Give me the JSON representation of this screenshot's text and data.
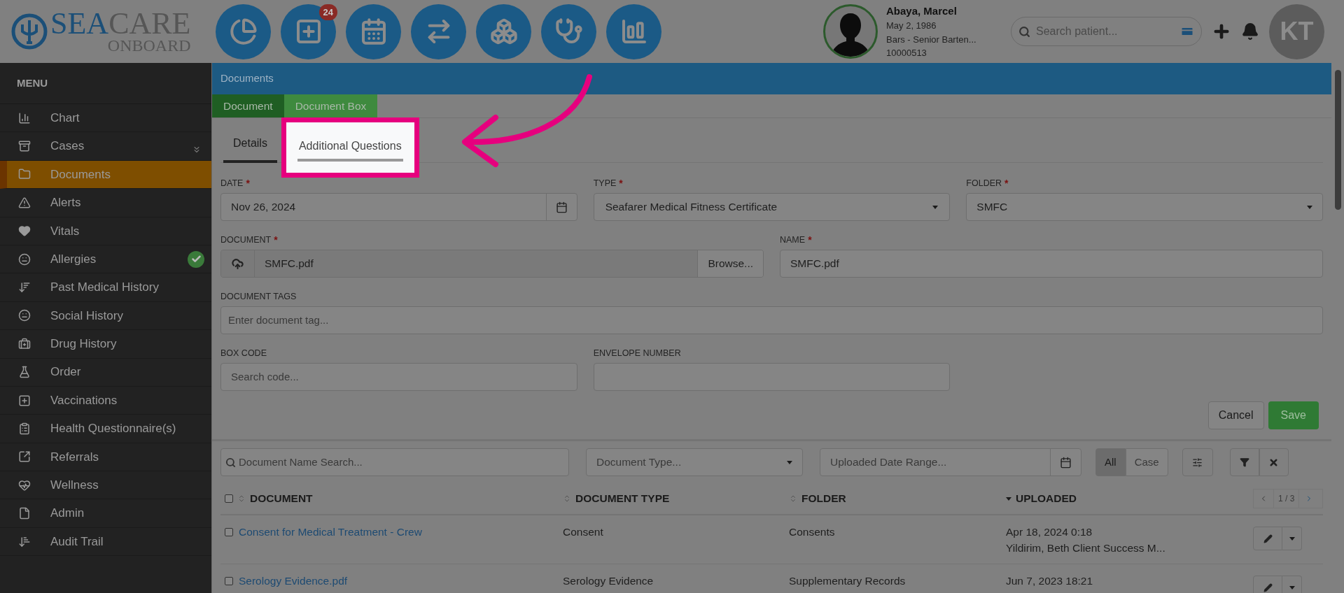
{
  "logo": {
    "title_a": "SEA",
    "title_b": "CARE",
    "subtitle": "ONBOARD"
  },
  "toolbar": {
    "badge": "24"
  },
  "patient": {
    "name": "Abaya, Marcel",
    "dob": "May 2, 1986",
    "role": "Bars - Senior Barten...",
    "id": "10000513"
  },
  "patient_search": {
    "placeholder": "Search patient..."
  },
  "user": {
    "initials": "KT"
  },
  "sidebar": {
    "title": "MENU",
    "items": [
      {
        "label": "Chart",
        "selected": false
      },
      {
        "label": "Cases",
        "selected": false,
        "expandable": true
      },
      {
        "label": "Documents",
        "selected": true
      },
      {
        "label": "Alerts",
        "selected": false
      },
      {
        "label": "Vitals",
        "selected": false
      },
      {
        "label": "Allergies",
        "selected": false,
        "verified": true
      },
      {
        "label": "Past Medical History",
        "selected": false
      },
      {
        "label": "Social History",
        "selected": false
      },
      {
        "label": "Drug History",
        "selected": false
      },
      {
        "label": "Order",
        "selected": false
      },
      {
        "label": "Vaccinations",
        "selected": false
      },
      {
        "label": "Health Questionnaire(s)",
        "selected": false
      },
      {
        "label": "Referrals",
        "selected": false
      },
      {
        "label": "Wellness",
        "selected": false
      },
      {
        "label": "Admin",
        "selected": false
      },
      {
        "label": "Audit Trail",
        "selected": false
      }
    ]
  },
  "page_title": "Documents",
  "doc_tabs": [
    {
      "label": "Document",
      "selected": true
    },
    {
      "label": "Document Box",
      "selected": false
    }
  ],
  "sub_tabs": [
    {
      "label": "Details",
      "selected": true,
      "highlighted": false
    },
    {
      "label": "Additional Questions",
      "selected": false,
      "highlighted": true
    }
  ],
  "form": {
    "date": {
      "label": "DATE",
      "marker": "*",
      "value": "Nov 26, 2024"
    },
    "type": {
      "label": "TYPE",
      "marker": "*",
      "value": "Seafarer Medical Fitness Certificate"
    },
    "folder": {
      "label": "FOLDER",
      "marker": "*",
      "value": "SMFC"
    },
    "document": {
      "label": "DOCUMENT",
      "marker": "*",
      "value": "SMFC.pdf",
      "button": "Browse..."
    },
    "name": {
      "label": "NAME",
      "marker": "*",
      "value": "SMFC.pdf"
    },
    "tags": {
      "label": "DOCUMENT TAGS",
      "placeholder": "Enter document tag..."
    },
    "box_code": {
      "label": "BOX CODE",
      "placeholder": "Search code..."
    },
    "envelope_number": {
      "label": "ENVELOPE NUMBER"
    }
  },
  "buttons": {
    "cancel": "Cancel",
    "save": "Save"
  },
  "filters": {
    "name_placeholder": "Document Name Search...",
    "type_placeholder": "Document Type...",
    "date_placeholder": "Uploaded Date Range...",
    "scope": [
      {
        "label": "All",
        "selected": true
      },
      {
        "label": "Case",
        "selected": false
      }
    ]
  },
  "table": {
    "columns": [
      {
        "label": "DOCUMENT",
        "sorted": false
      },
      {
        "label": "DOCUMENT TYPE",
        "sorted": false
      },
      {
        "label": "FOLDER",
        "sorted": false
      },
      {
        "label": "UPLOADED",
        "sorted": true
      }
    ],
    "select_all": {
      "checked": false
    },
    "pager": "1 / 3",
    "rows": [
      {
        "checked": false,
        "document": "Consent for Medical Treatment - Crew",
        "type": "Consent",
        "folder": "Consents",
        "uploaded": "Apr 18, 2024 0:18",
        "uploaded_by": "Yildirim, Beth Client Success M..."
      },
      {
        "checked": false,
        "document": "Serology Evidence.pdf",
        "type": "Serology Evidence",
        "folder": "Supplementary Records",
        "uploaded": "Jun 7, 2023 18:21"
      }
    ]
  }
}
